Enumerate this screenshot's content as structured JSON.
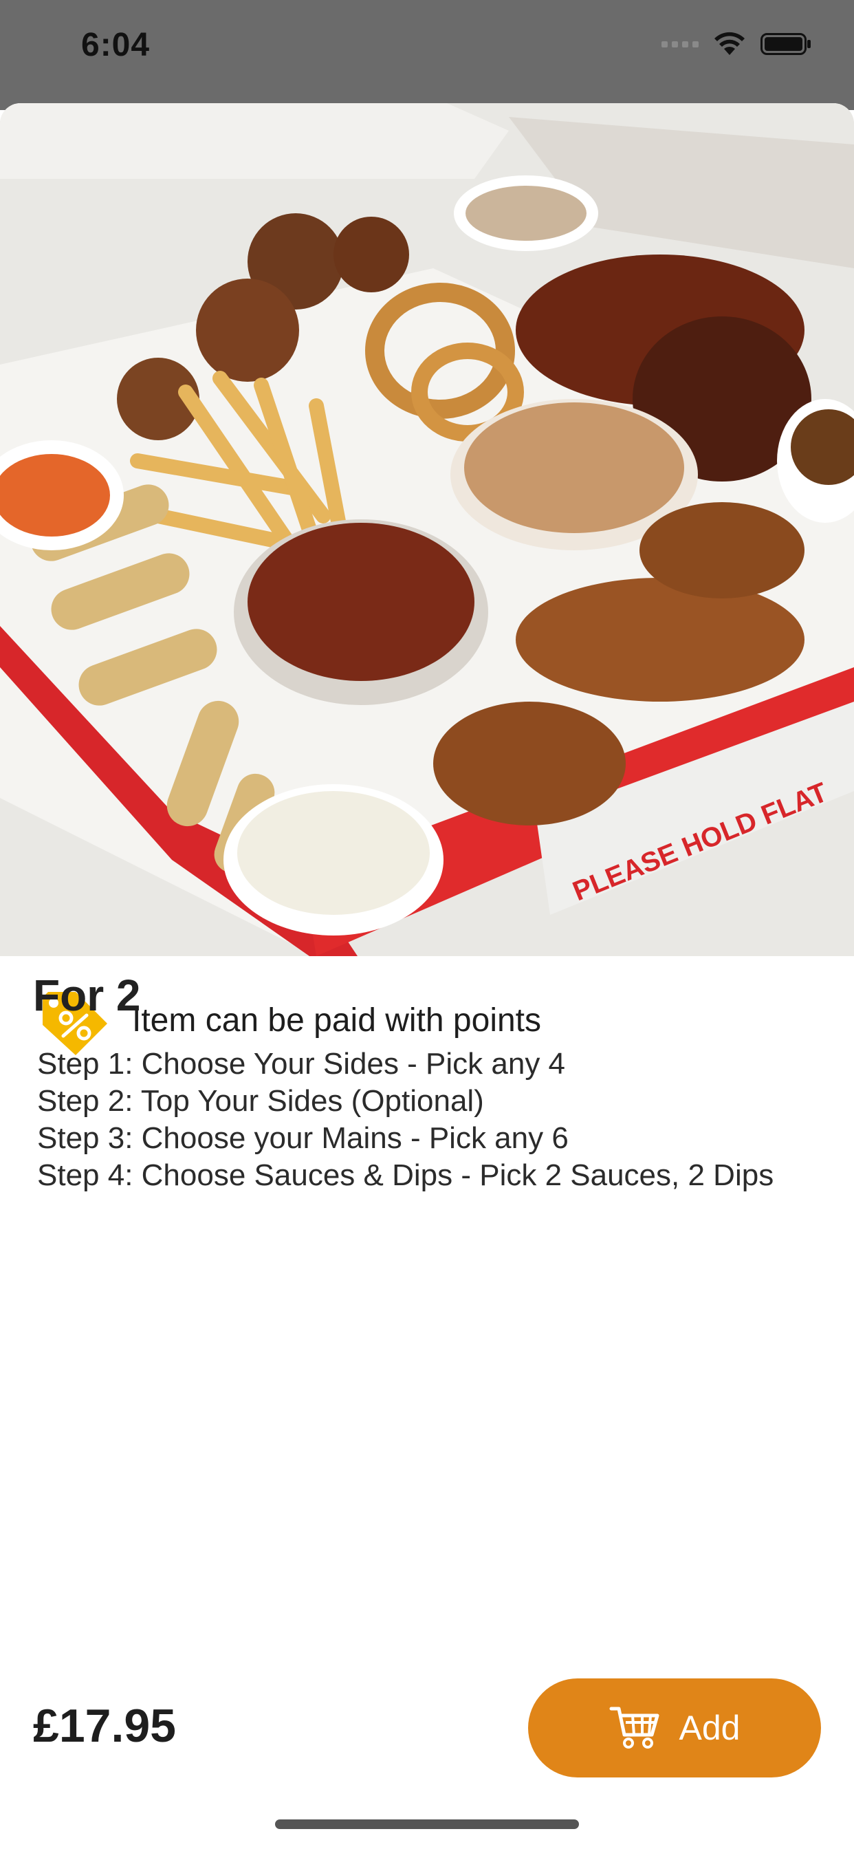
{
  "status_bar": {
    "time": "6:04",
    "icons": [
      "signal-icon",
      "wifi-icon",
      "battery-icon"
    ]
  },
  "hero": {
    "image_subject": "box of mixed sides and mains: wings, ribs, chips, onion rings, spring rolls, rice, chicken strips, sauce pots",
    "box_text": "PLEASE HOLD FLAT"
  },
  "points": {
    "icon": "discount-tag-icon",
    "text": "Item can be paid with points"
  },
  "product": {
    "title": "For 2",
    "steps": [
      "Step 1: Choose Your Sides - Pick any 4",
      "Step 2: Top Your Sides (Optional)",
      "Step 3: Choose your Mains - Pick any 6",
      "Step 4: Choose Sauces & Dips - Pick 2 Sauces, 2 Dips"
    ]
  },
  "footer": {
    "price": "£17.95",
    "add_label": "Add",
    "add_icon": "cart-icon"
  },
  "colors": {
    "accent": "#e08518",
    "tag_yellow": "#f5b800",
    "backdrop": "#6b6b6b"
  }
}
